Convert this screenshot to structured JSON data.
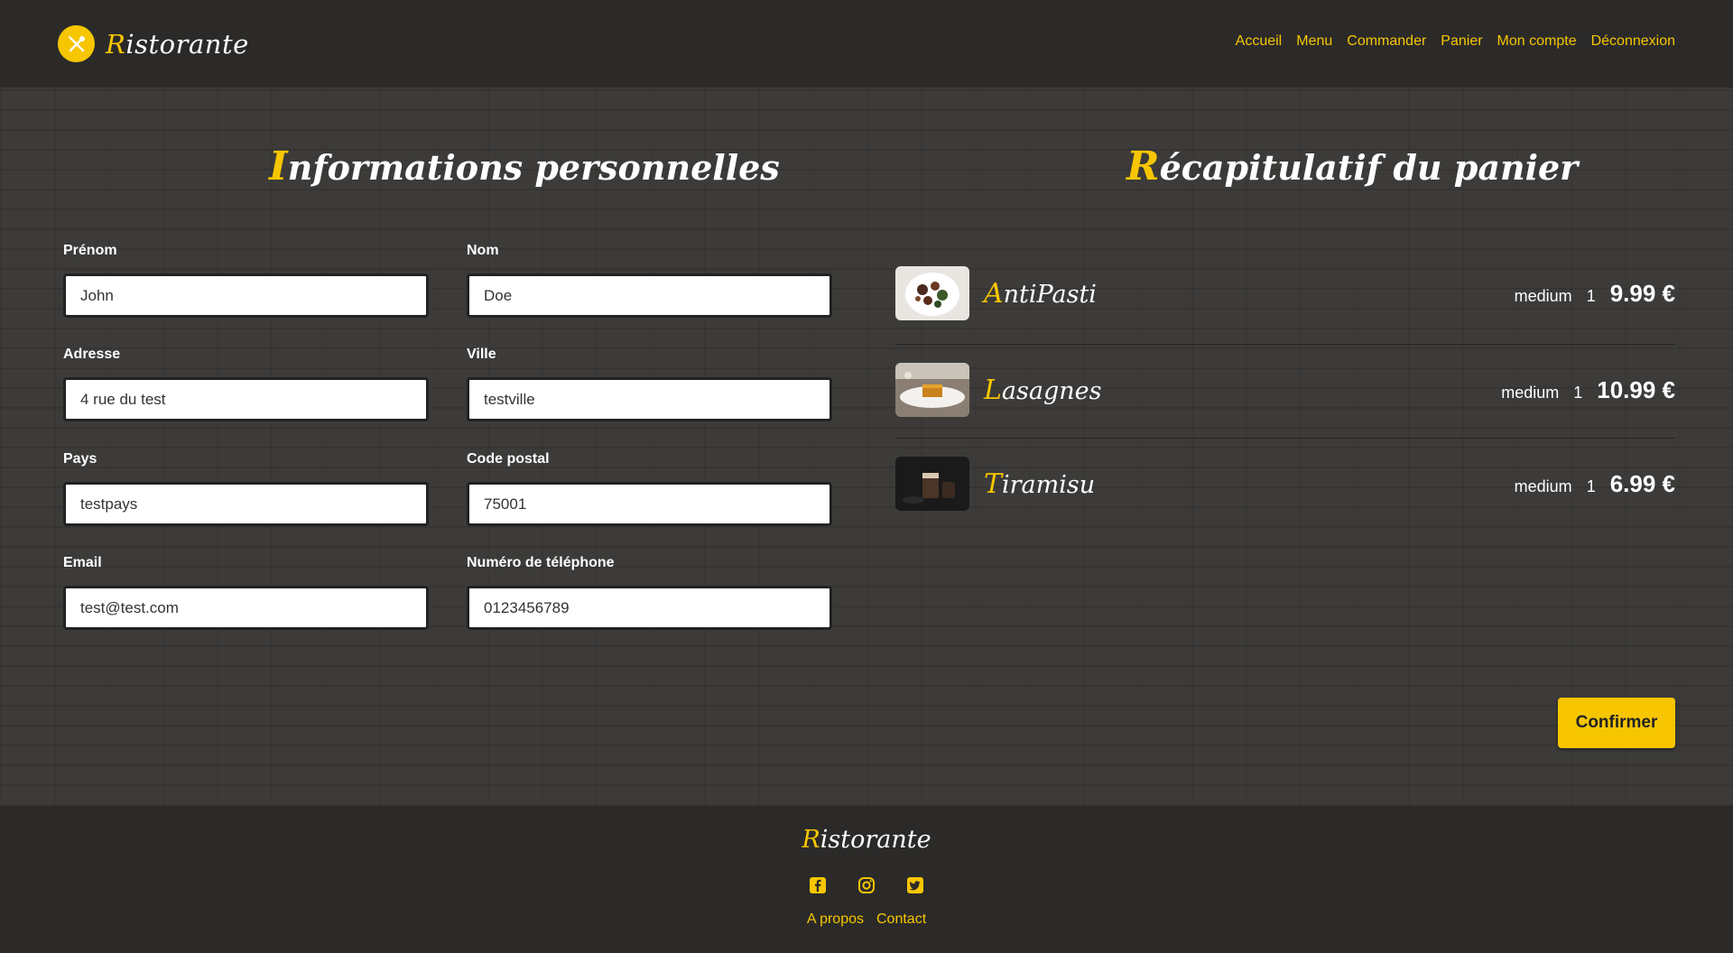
{
  "brand": {
    "name": "Ristorante",
    "accent_color": "#f7c600"
  },
  "nav": [
    "Accueil",
    "Menu",
    "Commander",
    "Panier",
    "Mon compte",
    "Déconnexion"
  ],
  "form": {
    "title": "Informations personnelles",
    "fields": [
      {
        "label": "Prénom",
        "value": "John"
      },
      {
        "label": "Nom",
        "value": "Doe"
      },
      {
        "label": "Adresse",
        "value": "4 rue du test"
      },
      {
        "label": "Ville",
        "value": "testville"
      },
      {
        "label": "Pays",
        "value": "testpays"
      },
      {
        "label": "Code postal",
        "value": "75001"
      },
      {
        "label": "Email",
        "value": "test@test.com"
      },
      {
        "label": "Numéro de téléphone",
        "value": "0123456789"
      }
    ]
  },
  "cart": {
    "title": "Récapitulatif du panier",
    "items": [
      {
        "name": "AntiPasti",
        "size": "medium",
        "qty": "1",
        "price": "9.99 €"
      },
      {
        "name": "Lasagnes",
        "size": "medium",
        "qty": "1",
        "price": "10.99 €"
      },
      {
        "name": "Tiramisu",
        "size": "medium",
        "qty": "1",
        "price": "6.99 €"
      }
    ],
    "confirm_label": "Confirmer"
  },
  "footer": {
    "brand": "Ristorante",
    "icons": [
      "facebook-icon",
      "instagram-icon",
      "twitter-icon"
    ],
    "links": [
      "A propos",
      "Contact"
    ]
  }
}
